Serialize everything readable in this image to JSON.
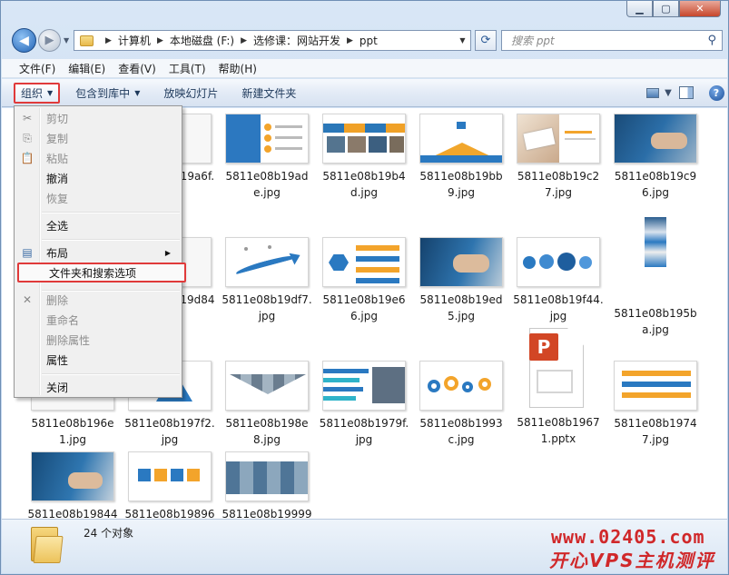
{
  "address": {
    "crumbs": [
      "计算机",
      "本地磁盘 (F:)",
      "选修课：网站开发",
      "ppt"
    ]
  },
  "search": {
    "placeholder": "搜索 ppt"
  },
  "menubar": [
    "文件(F)",
    "编辑(E)",
    "查看(V)",
    "工具(T)",
    "帮助(H)"
  ],
  "toolbar": {
    "organize": "组织",
    "include": "包含到库中",
    "slideshow": "放映幻灯片",
    "newfolder": "新建文件夹"
  },
  "files": [
    {
      "name": "5811e08b19a6f.jpg",
      "thumb": "hidden"
    },
    {
      "name": "5811e08b19ade.jpg",
      "thumb": "blue-list"
    },
    {
      "name": "5811e08b19b4d.jpg",
      "thumb": "team"
    },
    {
      "name": "5811e08b19bb9.jpg",
      "thumb": "mountain"
    },
    {
      "name": "5811e08b19c27.jpg",
      "thumb": "card"
    },
    {
      "name": "5811e08b19c96.jpg",
      "thumb": "handshake"
    },
    {
      "name": "5811e08b19d84",
      "thumb": "hidden"
    },
    {
      "name": "5811e08b19df7.jpg",
      "thumb": "arrow"
    },
    {
      "name": "5811e08b19e66.jpg",
      "thumb": "hexlist"
    },
    {
      "name": "5811e08b19ed5.jpg",
      "thumb": "handshake2"
    },
    {
      "name": "5811e08b19f44.jpg",
      "thumb": "globes"
    },
    {
      "name": "5811e08b195ba.jpg",
      "thumb": "tall"
    },
    {
      "name": "5811e08b196e1.jpg",
      "thumb": "hidden"
    },
    {
      "name": "5811e08b197f2.jpg",
      "thumb": "triangle"
    },
    {
      "name": "5811e08b198e8.jpg",
      "thumb": "triangles"
    },
    {
      "name": "5811e08b1979f.jpg",
      "thumb": "stripes"
    },
    {
      "name": "5811e08b1993c.jpg",
      "thumb": "gears"
    },
    {
      "name": "5811e08b19671.pptx",
      "thumb": "pptx"
    },
    {
      "name": "5811e08b19747.jpg",
      "thumb": "bars"
    },
    {
      "name": "5811e08b19844",
      "thumb": "handshake3"
    },
    {
      "name": "5811e08b19896",
      "thumb": "puzzle"
    },
    {
      "name": "5811e08b19999",
      "thumb": "hexphotos"
    }
  ],
  "status": {
    "count": "24 个对象"
  },
  "watermark": {
    "url": "www.02405.com",
    "text": "开心VPS主机测评"
  },
  "contextmenu": {
    "cut": "剪切",
    "copy": "复制",
    "paste": "粘贴",
    "undo": "撤消",
    "redo": "恢复",
    "selectall": "全选",
    "layout": "布局",
    "options": "文件夹和搜索选项",
    "delete": "删除",
    "rename": "重命名",
    "removeprops": "删除属性",
    "properties": "属性",
    "close": "关闭"
  }
}
